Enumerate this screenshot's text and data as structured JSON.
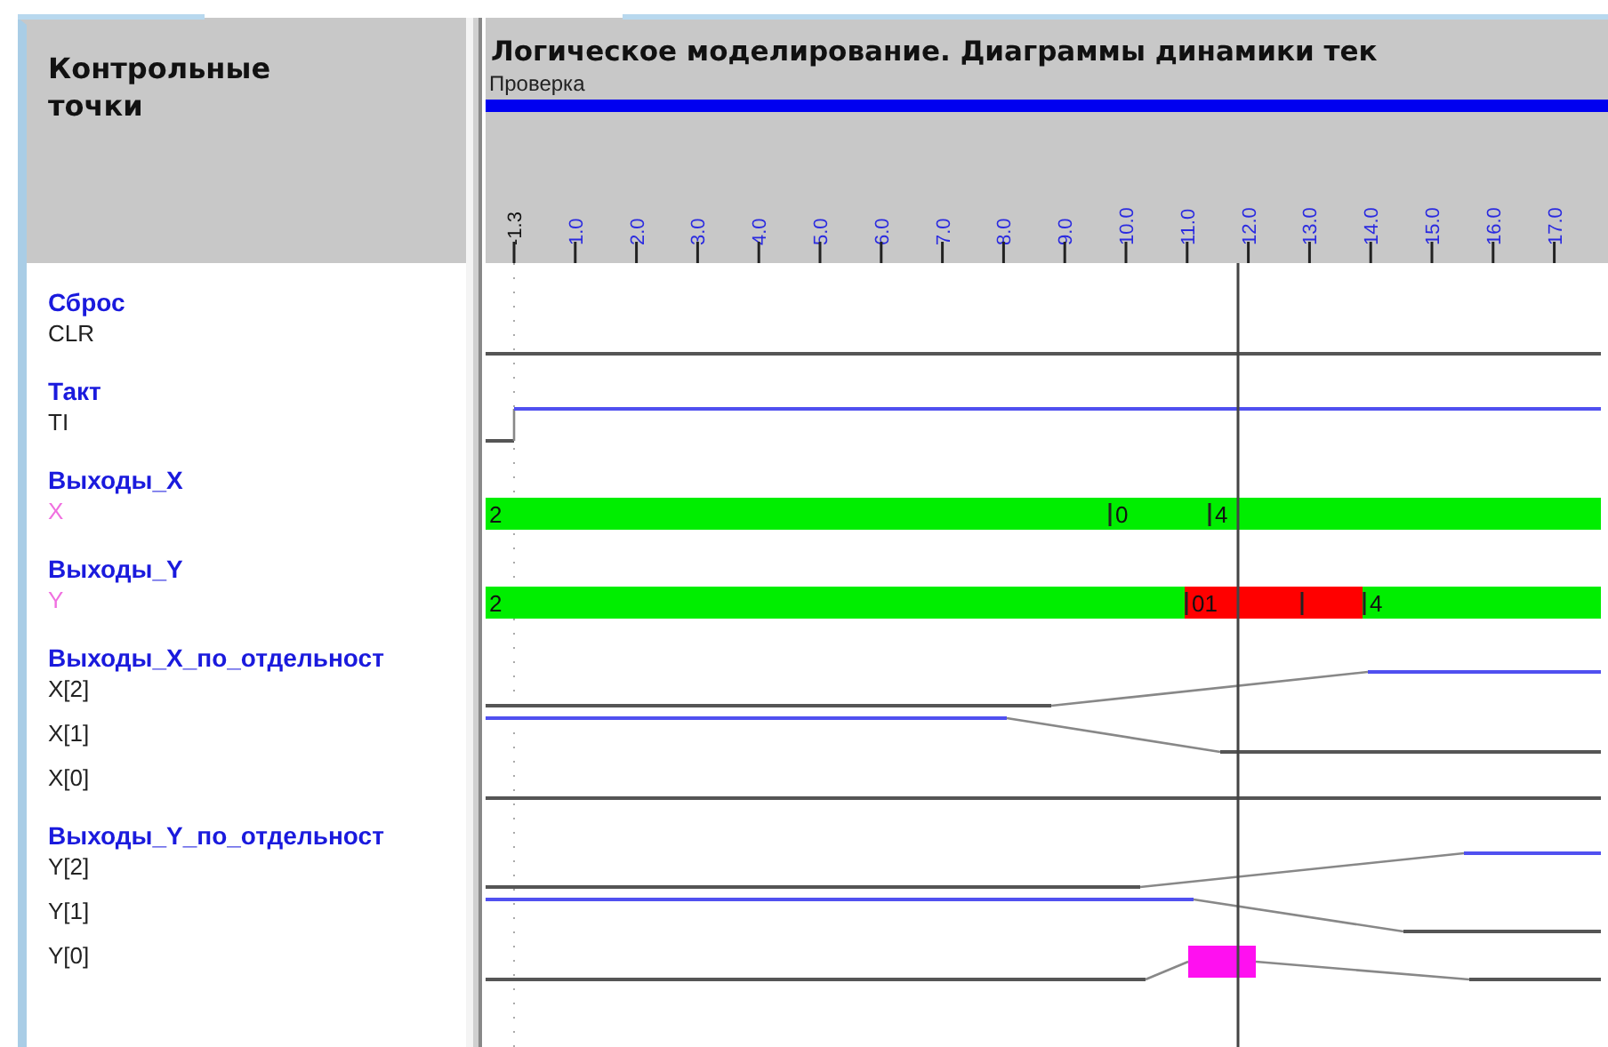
{
  "header": {
    "title": "Контрольные точки"
  },
  "diagram": {
    "title": "Логическое моделирование. Диаграммы динамики тек",
    "subtitle": "Проверка",
    "ticks": [
      {
        "label": "-1.3",
        "kind": "origin"
      },
      {
        "label": "1.0",
        "kind": "mark"
      },
      {
        "label": "2.0",
        "kind": "mark"
      },
      {
        "label": "3.0",
        "kind": "mark"
      },
      {
        "label": "4.0",
        "kind": "mark"
      },
      {
        "label": "5.0",
        "kind": "mark"
      },
      {
        "label": "6.0",
        "kind": "mark"
      },
      {
        "label": "7.0",
        "kind": "mark"
      },
      {
        "label": "8.0",
        "kind": "mark"
      },
      {
        "label": "9.0",
        "kind": "mark"
      },
      {
        "label": "10.0",
        "kind": "mark"
      },
      {
        "label": "11.0",
        "kind": "mark"
      },
      {
        "label": "12.0",
        "kind": "mark"
      },
      {
        "label": "13.0",
        "kind": "mark"
      },
      {
        "label": "14.0",
        "kind": "mark"
      },
      {
        "label": "15.0",
        "kind": "mark"
      },
      {
        "label": "16.0",
        "kind": "mark"
      },
      {
        "label": "17.0",
        "kind": "mark"
      }
    ]
  },
  "groups": [
    {
      "name": "Сброс",
      "signals": [
        {
          "name": "CLR",
          "kind": "bit"
        }
      ]
    },
    {
      "name": "Такт",
      "signals": [
        {
          "name": "TI",
          "kind": "bit"
        }
      ]
    },
    {
      "name": "Выходы_X",
      "signals": [
        {
          "name": "X",
          "kind": "bus",
          "segments": [
            {
              "text": "2",
              "color": "#00ee00"
            },
            {
              "text": "0",
              "color": "#00ee00"
            },
            {
              "text": "4",
              "color": "#00ee00"
            }
          ]
        }
      ]
    },
    {
      "name": "Выходы_Y",
      "signals": [
        {
          "name": "Y",
          "kind": "bus",
          "segments": [
            {
              "text": "2",
              "color": "#00ee00"
            },
            {
              "text": "01",
              "color": "#ff0000"
            },
            {
              "color": "#ff0000"
            },
            {
              "text": "4",
              "color": "#00ee00"
            }
          ]
        }
      ]
    },
    {
      "name": "Выходы_X_по_отдельност",
      "signals": [
        {
          "name": "X[2]",
          "kind": "bit"
        },
        {
          "name": "X[1]",
          "kind": "bit"
        },
        {
          "name": "X[0]",
          "kind": "bit"
        }
      ]
    },
    {
      "name": "Выходы_Y_по_отдельност",
      "signals": [
        {
          "name": "Y[2]",
          "kind": "bit"
        },
        {
          "name": "Y[1]",
          "kind": "bit"
        },
        {
          "name": "Y[0]",
          "kind": "bit"
        }
      ]
    }
  ]
}
